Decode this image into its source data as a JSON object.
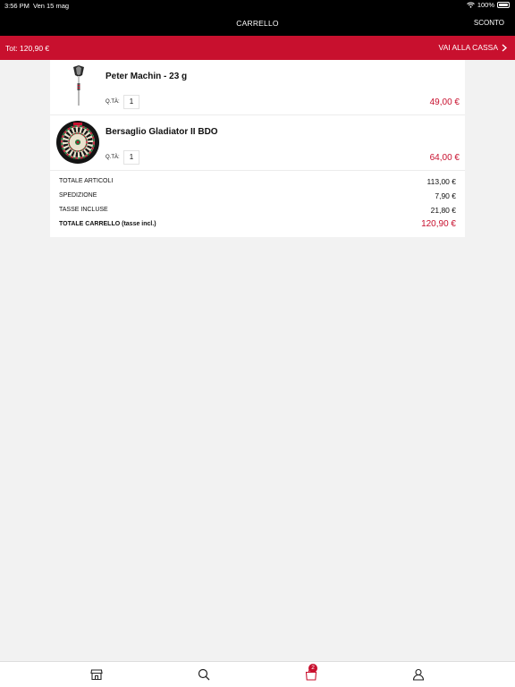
{
  "status_bar": {
    "time": "3:56 PM",
    "date": "Ven 15 mag",
    "battery": "100%"
  },
  "header": {
    "title": "CARRELLO",
    "discount_label": "SCONTO"
  },
  "cart_bar": {
    "total": "Tot: 120,90 €",
    "checkout_label": "VAI ALLA CASSA"
  },
  "items": [
    {
      "name": "Peter Machin - 23 g",
      "qty_label": "Q.TÀ:",
      "qty": "1",
      "price": "49,00 €",
      "thumb": "dart-icon"
    },
    {
      "name": "Bersaglio Gladiator II BDO",
      "qty_label": "Q.TÀ:",
      "qty": "1",
      "price": "64,00 €",
      "thumb": "dartboard-icon"
    }
  ],
  "summary": {
    "items_total_label": "TOTALE ARTICOLI",
    "items_total_value": "113,00 €",
    "shipping_label": "SPEDIZIONE",
    "shipping_value": "7,90 €",
    "taxes_label": "TASSE INCLUSE",
    "taxes_value": "21,80 €",
    "cart_total_label": "TOTALE CARRELLO (tasse incl.)",
    "cart_total_value": "120,90 €"
  },
  "tab_bar": {
    "tabs": [
      "store-icon",
      "search-icon",
      "bag-icon",
      "user-icon"
    ],
    "cart_badge": "2"
  },
  "colors": {
    "accent": "#c8102e",
    "header": "#000000"
  }
}
